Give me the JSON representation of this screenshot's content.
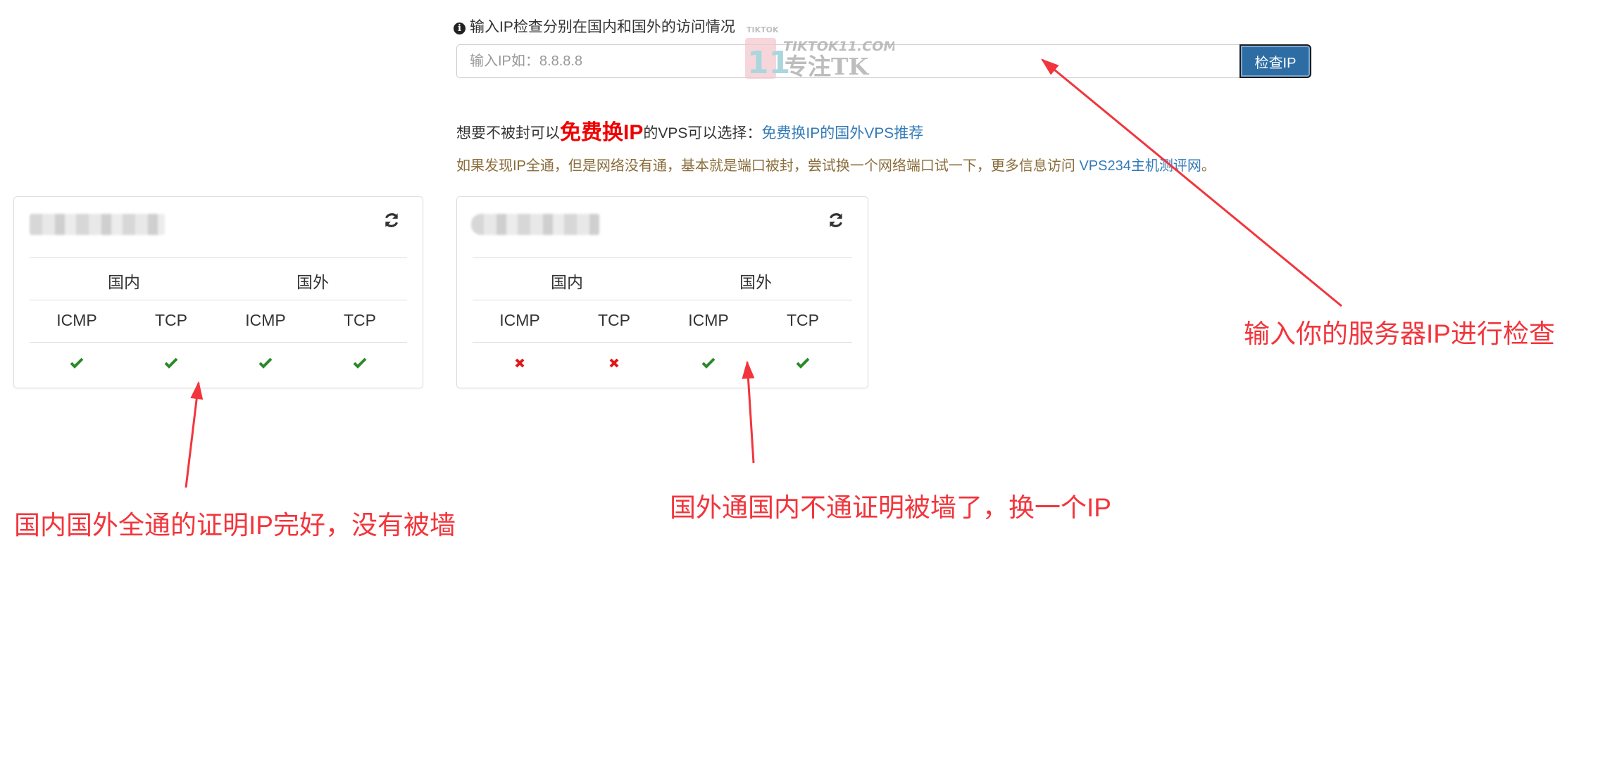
{
  "search": {
    "label": "输入IP检查分别在国内和国外的访问情况",
    "placeholder": "输入IP如：8.8.8.8",
    "value": "",
    "button_label": "检查IP"
  },
  "watermark": {
    "line1": "TIKTOK",
    "line2": "TIKTOK11.COM",
    "line3": "专注TK",
    "badge": "11"
  },
  "promo": {
    "prefix": "想要不被封可以",
    "highlight": "免费换IP",
    "middle": "的VPS可以选择：",
    "link_text": "免费换IP的国外VPS推荐"
  },
  "tip": {
    "text": "如果发现IP全通，但是网络没有通，基本就是端口被封，尝试换一个网络端口试一下，更多信息访问 ",
    "link_text": "VPS234主机测评网",
    "suffix": "。"
  },
  "results": [
    {
      "host": "",
      "group_domestic": "国内",
      "group_foreign": "国外",
      "columns": [
        "ICMP",
        "TCP",
        "ICMP",
        "TCP"
      ],
      "status": [
        "ok",
        "ok",
        "ok",
        "ok"
      ]
    },
    {
      "host": "",
      "group_domestic": "国内",
      "group_foreign": "国外",
      "columns": [
        "ICMP",
        "TCP",
        "ICMP",
        "TCP"
      ],
      "status": [
        "fail",
        "fail",
        "ok",
        "ok"
      ]
    }
  ],
  "annotations": {
    "top_right": "输入你的服务器IP进行检查",
    "left": "国内国外全通的证明IP完好，没有被墙",
    "middle": "国外通国内不通证明被墙了，换一个IP"
  },
  "colors": {
    "ok": "#2a8a2a",
    "fail": "#e0181b",
    "annotation": "#f2353c",
    "button": "#2e6da4",
    "link": "#337ab7"
  }
}
